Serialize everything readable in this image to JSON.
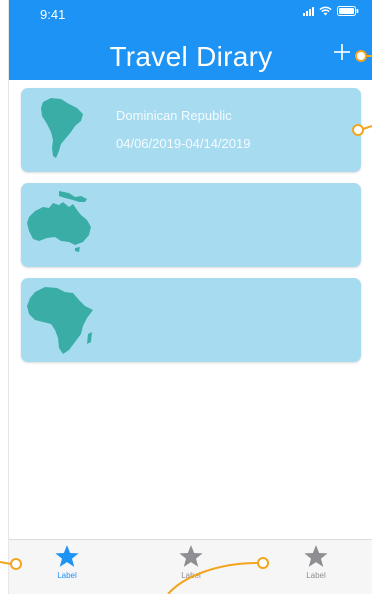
{
  "status_bar": {
    "time": "9:41"
  },
  "header": {
    "title": "Travel Dirary",
    "add_symbol": "+"
  },
  "trips": [
    {
      "country": "Dominican Republic",
      "dates": "04/06/2019-04/14/2019",
      "map_icon": "south-america-map"
    },
    {
      "country": "",
      "dates": "",
      "map_icon": "australia-map"
    },
    {
      "country": "",
      "dates": "",
      "map_icon": "africa-map"
    }
  ],
  "tabs": [
    {
      "label": "Label",
      "active": true
    },
    {
      "label": "Label",
      "active": false
    },
    {
      "label": "Label",
      "active": false
    }
  ],
  "colors": {
    "header": "#1d93f5",
    "card": "#a7dcf0",
    "map": "#3aaea6",
    "tab_active": "#1d93f5",
    "tab_inactive": "#8e8e93",
    "annotation": "#f3a51d"
  }
}
